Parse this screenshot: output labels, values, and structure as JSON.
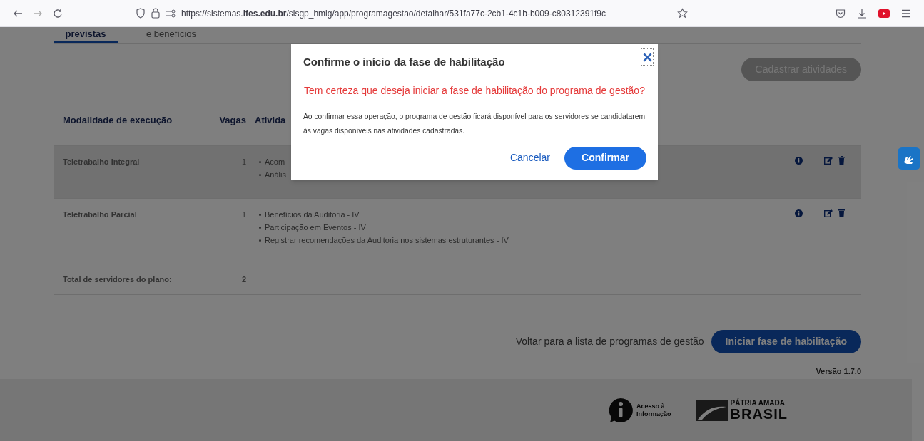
{
  "browser": {
    "url": "https://sistemas.**ifes.edu.br**/sisgp_hmlg/app/programagestao/detalhar/531fa77c-2cb1-4c1b-b009-c80312391f9c"
  },
  "tabs": [
    {
      "label": "previstas",
      "selected": true
    },
    {
      "label": "e benefícios",
      "selected": false
    }
  ],
  "register_button": {
    "label": "Cadastrar atividades",
    "disabled": true
  },
  "table": {
    "columns": [
      "Modalidade de execução",
      "Vagas",
      "Ativida"
    ],
    "rows": [
      {
        "modality": "Teletrabalho Integral",
        "vacancies": "1",
        "activities": [
          "Acom",
          "Anális"
        ],
        "hovered": true
      },
      {
        "modality": "Teletrabalho Parcial",
        "vacancies": "1",
        "activities": [
          "Benefícios da Auditoria - IV",
          "Participação em Eventos - IV",
          "Registrar recomendações da Auditoria nos sistemas estruturantes - IV"
        ],
        "hovered": false
      }
    ],
    "total": {
      "label": "Total de servidores do plano:",
      "value": "2"
    }
  },
  "back_link": "Voltar para a lista de programas de gestão",
  "start_button": "Iniciar fase de habilitação",
  "version": "Versão 1.7.0",
  "footer": {
    "access_info": [
      "Acesso à",
      "Informação"
    ],
    "brand_top": "PÁTRIA AMADA",
    "brand_main": "BRASIL"
  },
  "modal": {
    "title": "Confirme o início da fase de habilitação",
    "question": "Tem certeza que deseja iniciar a fase de habilitação do programa de gestão?",
    "message": "Ao confirmar essa operação, o programa de gestão ficará disponível para os servidores se candidatarem às vagas disponíveis nas atividades cadastradas.",
    "cancel": "Cancelar",
    "confirm": "Confirmar"
  }
}
